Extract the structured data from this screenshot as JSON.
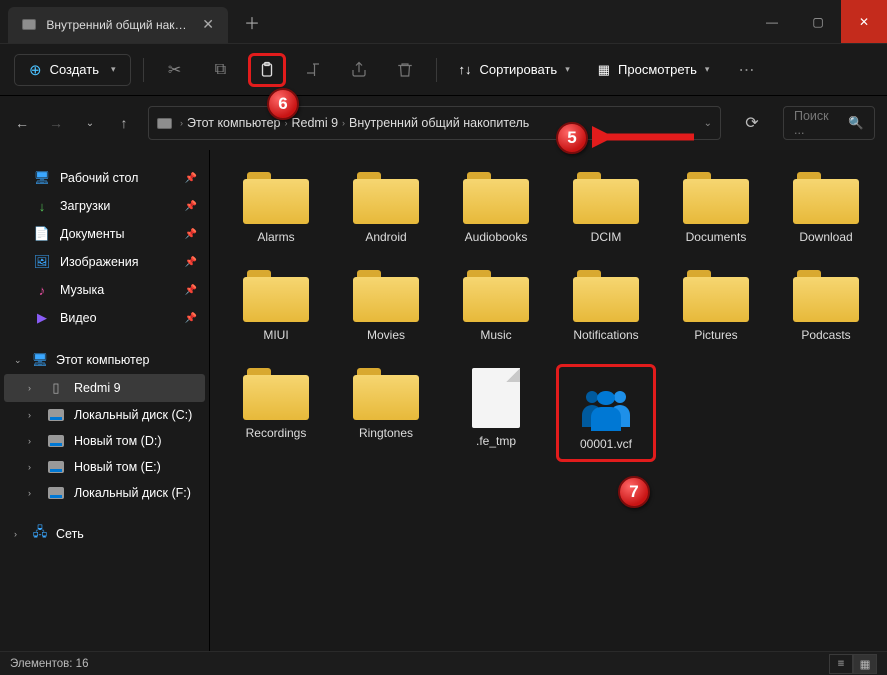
{
  "titlebar": {
    "tab_title": "Внутренний общий накопит",
    "tab_icon": "drive-icon"
  },
  "toolbar": {
    "new_label": "Создать",
    "sort_label": "Сортировать",
    "view_label": "Просмотреть"
  },
  "breadcrumb": {
    "parts": [
      "Этот компьютер",
      "Redmi 9",
      "Внутренний общий накопитель"
    ]
  },
  "search": {
    "placeholder": "Поиск ..."
  },
  "sidebar": {
    "quick": [
      {
        "label": "Рабочий стол",
        "icon": "🖥",
        "color": "#3aa7ff"
      },
      {
        "label": "Загрузки",
        "icon": "↓",
        "color": "#55c457"
      },
      {
        "label": "Документы",
        "icon": "📄",
        "color": "#b0b0b0"
      },
      {
        "label": "Изображения",
        "icon": "🖼",
        "color": "#3aa7ff"
      },
      {
        "label": "Музыка",
        "icon": "♪",
        "color": "#e94fa1"
      },
      {
        "label": "Видео",
        "icon": "▶",
        "color": "#8a5cf6"
      }
    ],
    "pc_label": "Этот компьютер",
    "redmi": "Redmi 9",
    "drives": [
      {
        "label": "Локальный диск (C:)"
      },
      {
        "label": "Новый том (D:)"
      },
      {
        "label": "Новый том (E:)"
      },
      {
        "label": "Локальный диск (F:)"
      }
    ],
    "network": "Сеть"
  },
  "files": [
    {
      "name": "Alarms",
      "type": "folder"
    },
    {
      "name": "Android",
      "type": "folder"
    },
    {
      "name": "Audiobooks",
      "type": "folder"
    },
    {
      "name": "DCIM",
      "type": "folder"
    },
    {
      "name": "Documents",
      "type": "folder"
    },
    {
      "name": "Download",
      "type": "folder"
    },
    {
      "name": "MIUI",
      "type": "folder"
    },
    {
      "name": "Movies",
      "type": "folder"
    },
    {
      "name": "Music",
      "type": "folder"
    },
    {
      "name": "Notifications",
      "type": "folder"
    },
    {
      "name": "Pictures",
      "type": "folder"
    },
    {
      "name": "Podcasts",
      "type": "folder"
    },
    {
      "name": "Recordings",
      "type": "folder"
    },
    {
      "name": "Ringtones",
      "type": "folder"
    },
    {
      "name": ".fe_tmp",
      "type": "file"
    },
    {
      "name": "00001.vcf",
      "type": "vcf",
      "highlight": true
    }
  ],
  "status": {
    "count_label": "Элементов: 16"
  },
  "callouts": {
    "c5": "5",
    "c6": "6",
    "c7": "7"
  }
}
